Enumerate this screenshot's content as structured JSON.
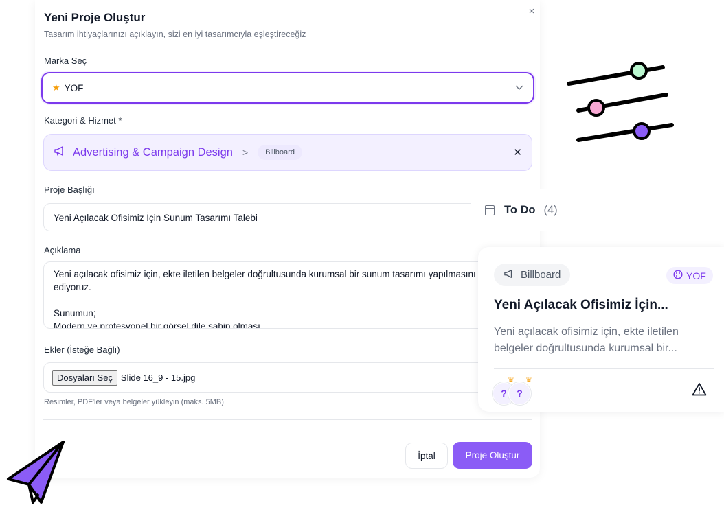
{
  "modal": {
    "title": "Yeni Proje Oluştur",
    "subtitle": "Tasarım ihtiyaçlarınızı açıklayın, sizi en iyi tasarımcıyla eşleştireceğiz",
    "close_glyph": "×",
    "brand": {
      "label": "Marka Seç",
      "selected": "YOF",
      "icon": "star-icon"
    },
    "category": {
      "label": "Kategori & Hizmet *",
      "selected": "Advertising & Campaign Design",
      "separator": ">",
      "service": "Billboard",
      "clear_glyph": "✕",
      "icon": "megaphone-icon"
    },
    "project_title": {
      "label": "Proje Başlığı",
      "value": "Yeni Açılacak Ofisimiz İçin Sunum Tasarımı Talebi"
    },
    "description": {
      "label": "Açıklama",
      "value": "Yeni açılacak ofisimiz için, ekte iletilen belgeler doğrultusunda kurumsal bir sunum tasarımı yapılmasını talep\nediyoruz.\n\nSunumun;\nModern ve profesyonel bir görsel dile sahip olması"
    },
    "attachments": {
      "label": "Ekler (İsteğe Bağlı)",
      "button": "Dosyaları Seç",
      "file_name": "Slide 16_9 - 15.jpg",
      "hint": "Resimler, PDF'ler veya belgeler yükleyin (maks. 5MB)"
    },
    "buttons": {
      "cancel": "İptal",
      "create": "Proje Oluştur"
    },
    "accent_color": "#7c3aed"
  },
  "todo": {
    "title": "To Do",
    "count": "(4)"
  },
  "task_card": {
    "category": "Billboard",
    "brand": "YOF",
    "title": "Yeni Açılacak Ofisimiz İçin...",
    "description": "Yeni açılacak ofisimiz için, ekte iletilen belgeler doğrultusunda kurumsal bir...",
    "avatars": [
      "?",
      "?"
    ],
    "warning_icon": "alert-triangle-icon"
  },
  "decorations": {
    "slider_knob_colors": [
      "#bbf7d0",
      "#f9a8d4",
      "#8b5cf6"
    ],
    "paper_plane_color": "#8b5cf6"
  }
}
